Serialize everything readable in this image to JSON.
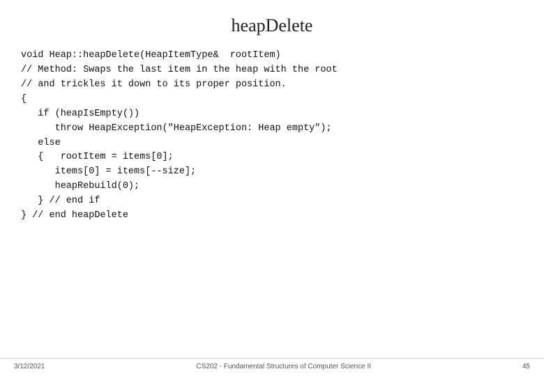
{
  "title": "heapDelete",
  "code": {
    "lines": [
      "void Heap::heapDelete(HeapItemType&  rootItem)",
      "// Method: Swaps the last item in the heap with the root",
      "// and trickles it down to its proper position.",
      "{",
      "   if (heapIsEmpty())",
      "      throw HeapException(\"HeapException: Heap empty\");",
      "   else",
      "   {   rootItem = items[0];",
      "      items[0] = items[--size];",
      "      heapRebuild(0);",
      "   } // end if",
      "} // end heapDelete"
    ]
  },
  "footer": {
    "date": "3/12/2021",
    "course": "CS202 - Fundamental Structures of Computer Science II",
    "page": "45"
  }
}
